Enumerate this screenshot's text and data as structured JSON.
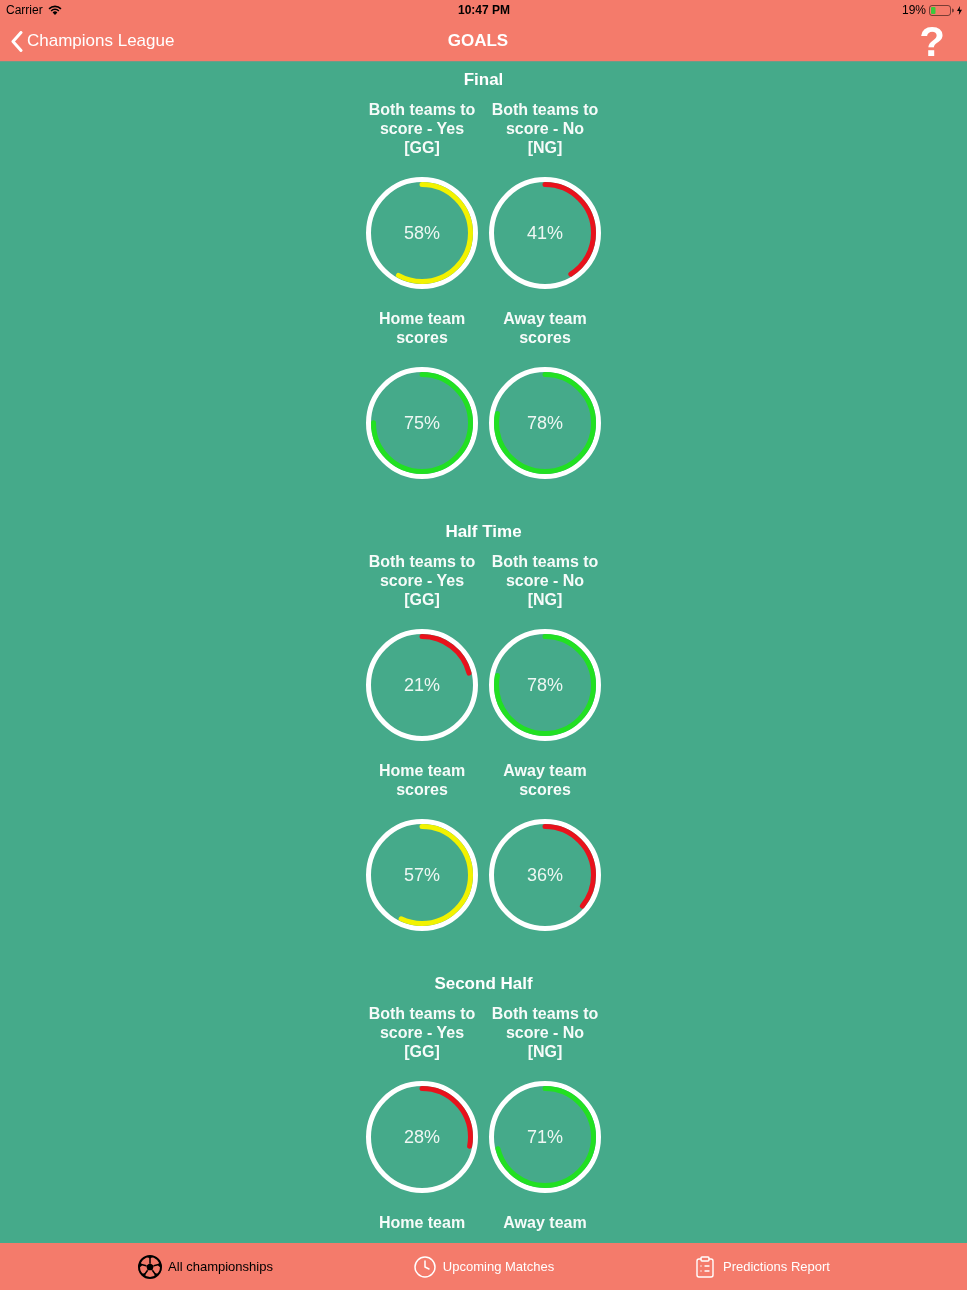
{
  "status_bar": {
    "carrier": "Carrier",
    "time": "10:47 PM",
    "battery": "19%"
  },
  "nav_bar": {
    "back": "Champions League",
    "title": "GOALS",
    "help": "?"
  },
  "sections": [
    {
      "title": "Final",
      "gauges": [
        {
          "label": "Both teams to score - Yes [GG]",
          "value": "58%",
          "level": 0.58,
          "color": "#f2f200"
        },
        {
          "label": "Both teams to score - No [NG]",
          "value": "41%",
          "level": 0.41,
          "color": "#e8121c"
        },
        {
          "label": "Home team scores",
          "value": "75%",
          "level": 0.75,
          "color": "#22e022"
        },
        {
          "label": "Away team scores",
          "value": "78%",
          "level": 0.78,
          "color": "#22e022"
        }
      ]
    },
    {
      "title": "Half Time",
      "gauges": [
        {
          "label": "Both teams to score - Yes [GG]",
          "value": "21%",
          "level": 0.21,
          "color": "#e8121c"
        },
        {
          "label": "Both teams to score - No [NG]",
          "value": "78%",
          "level": 0.78,
          "color": "#22e022"
        },
        {
          "label": "Home team scores",
          "value": "57%",
          "level": 0.57,
          "color": "#f2f200"
        },
        {
          "label": "Away team scores",
          "value": "36%",
          "level": 0.36,
          "color": "#e8121c"
        }
      ]
    },
    {
      "title": "Second Half",
      "gauges": [
        {
          "label": "Both teams to score - Yes [GG]",
          "value": "28%",
          "level": 0.28,
          "color": "#e8121c"
        },
        {
          "label": "Both teams to score - No [NG]",
          "value": "71%",
          "level": 0.71,
          "color": "#22e022"
        },
        {
          "label": "Home team"
        },
        {
          "label": "Away team"
        }
      ]
    }
  ],
  "tab_bar": {
    "items": [
      {
        "label": "All championships",
        "selected": true
      },
      {
        "label": "Upcoming Matches",
        "selected": false
      },
      {
        "label": "Predictions Report",
        "selected": false
      }
    ]
  }
}
